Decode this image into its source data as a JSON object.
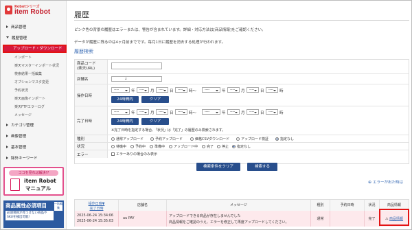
{
  "logo": {
    "series": "Robotシリーズ",
    "name": "item Robot"
  },
  "nav": {
    "items": [
      {
        "label": "商品管理",
        "expanded": false
      },
      {
        "label": "履歴管理",
        "expanded": true
      },
      {
        "label": "カテゴリ管理",
        "expanded": false
      },
      {
        "label": "画像管理",
        "expanded": false
      },
      {
        "label": "基本管理",
        "expanded": false
      },
      {
        "label": "除外キーワード",
        "expanded": false
      }
    ],
    "history_sub": [
      "アップロード・ダウンロード",
      "インポート",
      "楽天マスターインポート状況",
      "検索結果一括編集",
      "オプションマスタ変更",
      "予約状況",
      "楽天画像インポート",
      "楽天FTPエラーログ",
      "メッセージ"
    ]
  },
  "banners": {
    "manual_top": "ココを見れば解決!?",
    "manual_title": "item Robot",
    "manual_sub": "マニュアル",
    "attr_title": "商品属性必須項目",
    "attr_side": "一括編集",
    "attr_text": "必須項目が見つけない商品やSKUを検出可能!"
  },
  "page": {
    "title": "履歴",
    "note1": "ピンク色の背景の履歴はエラーまたは、警告が含まれています。詳細・対応方法は[商品情報]をご確認ください。",
    "note2": "データが履歴に残るのは4ヶ月前までです。毎月1日に履歴を消去する処理が行われます。",
    "section": "履歴検索"
  },
  "form": {
    "product_code": "商品コード\n(楽天URL)",
    "store": "店舗名",
    "store_value": "↓",
    "operation_date": "操作日時",
    "complete_date": "完了日時",
    "dash": "----",
    "year": "年",
    "month": "月",
    "day": "日",
    "hour": "時",
    "range_hour": "時〜",
    "btn_24h": "24時間内",
    "btn_clear": "クリア",
    "complete_note": "※完了日時を指定する場合、「状況」は「完了」の履歴のみ検索されます。",
    "type_label": "種別",
    "types": [
      "通常アップロード",
      "予約アップロード",
      "価格CSVダウンロード",
      "アップロード検証",
      "指定なし"
    ],
    "status_label": "状況",
    "statuses": [
      "待機中",
      "予約中",
      "準備中",
      "アップロード中",
      "完了",
      "停止",
      "指定なし"
    ],
    "error_label": "エラー",
    "error_check": "エラーありの場合のみ表示",
    "btn_reset": "検索条件をクリア",
    "btn_search": "検索する",
    "error_link": "エラーが出た時は"
  },
  "table": {
    "headers": {
      "op_date": "操作日時▼",
      "done_date": "完了日時",
      "store": "店舗名",
      "message": "メッセージ",
      "type": "種別",
      "reserve": "予約日時",
      "status": "状況",
      "info": "商品情報"
    },
    "row": {
      "op_date": "2025-06-24 15:34:06",
      "done_date": "2025-06-24 15:35:03",
      "store": "au PAY",
      "msg1": "アップロードできる商品が存在しませんでした",
      "msg2": "商品情報をご確認のうえ、エラーを修正して再度アップロードしてください。",
      "type": "通常",
      "reserve": "",
      "status": "完了",
      "info": "商品情報"
    }
  },
  "colors": {
    "accent": "#284e8c",
    "active": "#d7193c",
    "highlight": "#e31313",
    "error_row": "#fde9ec"
  }
}
